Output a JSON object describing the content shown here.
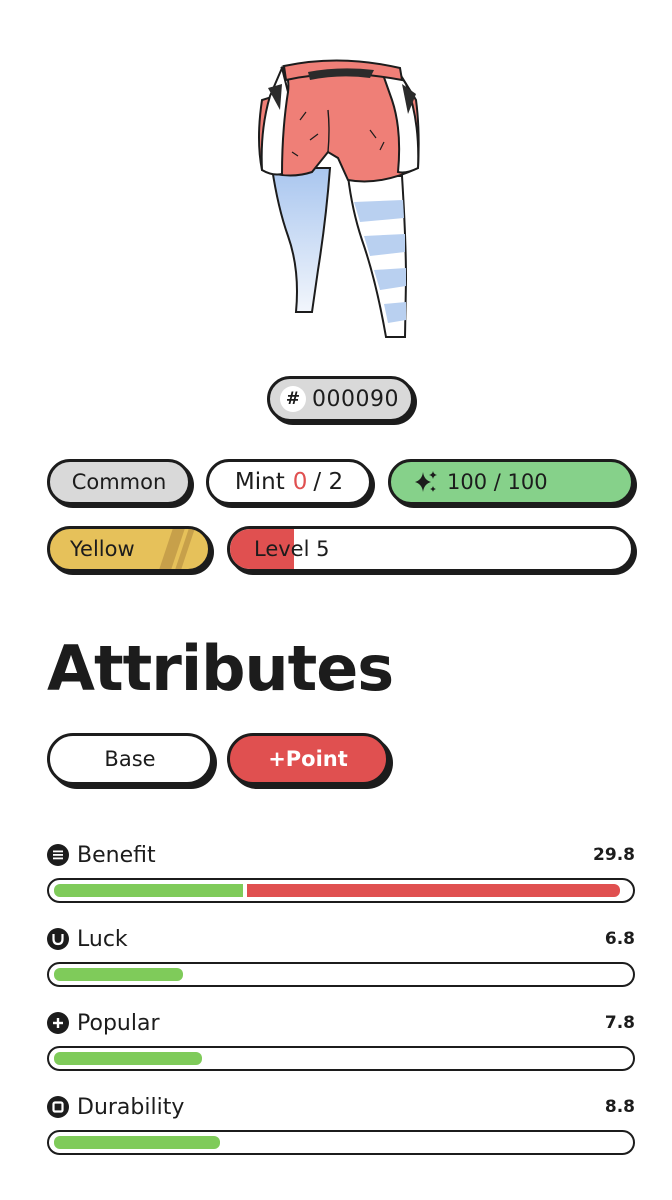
{
  "item": {
    "id_prefix": "#",
    "id": "000090"
  },
  "badges": {
    "rarity": "Common",
    "mint_label": "Mint",
    "mint_current": "0",
    "mint_max": "/ 2",
    "energy": "100 / 100",
    "color": "Yellow",
    "level": "Level 5",
    "level_progress": 0.16
  },
  "attributes": {
    "title": "Attributes",
    "tabs": [
      {
        "label": "Base",
        "active": false
      },
      {
        "label": "+Point",
        "active": true
      }
    ],
    "stats": [
      {
        "name": "Benefit",
        "value": "29.8",
        "icon": "list-icon",
        "base_fraction": 0.33,
        "point_fraction": 0.65
      },
      {
        "name": "Luck",
        "value": "6.8",
        "icon": "horseshoe-icon",
        "base_fraction": 0.225,
        "point_fraction": 0
      },
      {
        "name": "Popular",
        "value": "7.8",
        "icon": "plus-icon",
        "base_fraction": 0.258,
        "point_fraction": 0
      },
      {
        "name": "Durability",
        "value": "8.8",
        "icon": "square-icon",
        "base_fraction": 0.29,
        "point_fraction": 0
      }
    ]
  },
  "colors": {
    "accent_red": "#e05050",
    "accent_green": "#7fcb5a",
    "energy_green": "#86d18a",
    "yellow": "#e6c15a",
    "gray": "#d9d9d9",
    "ink": "#1c1c1c"
  }
}
